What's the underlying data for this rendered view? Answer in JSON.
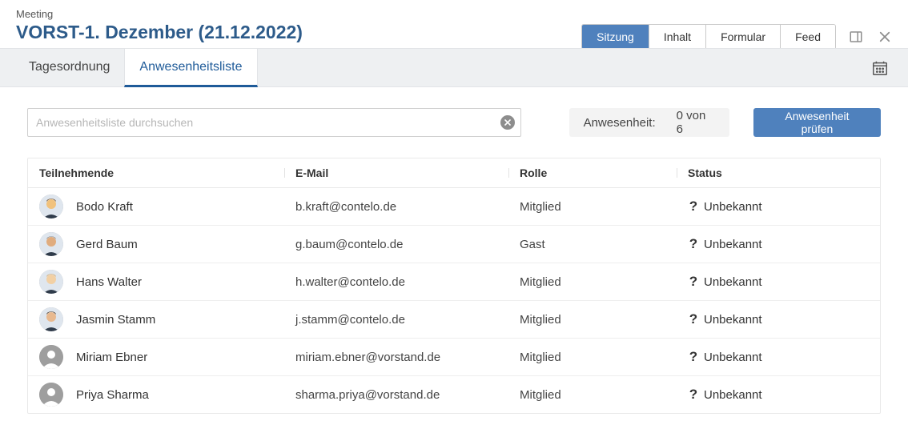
{
  "header": {
    "crumb": "Meeting",
    "title": "VORST-1. Dezember (21.12.2022)",
    "segments": [
      "Sitzung",
      "Inhalt",
      "Formular",
      "Feed"
    ],
    "active_segment": 0
  },
  "tabs": {
    "items": [
      "Tagesordnung",
      "Anwesenheitsliste"
    ],
    "active": 1
  },
  "toolbar": {
    "search_placeholder": "Anwesenheitsliste durchsuchen",
    "summary_label": "Anwesenheit:",
    "summary_value": "0 von 6",
    "check_button": "Anwesenheit prüfen"
  },
  "table": {
    "headers": [
      "Teilnehmende",
      "E-Mail",
      "Rolle",
      "Status"
    ],
    "rows": [
      {
        "name": "Bodo Kraft",
        "email": "b.kraft@contelo.de",
        "role": "Mitglied",
        "status": "Unbekannt",
        "placeholder": false
      },
      {
        "name": "Gerd Baum",
        "email": "g.baum@contelo.de",
        "role": "Gast",
        "status": "Unbekannt",
        "placeholder": false
      },
      {
        "name": "Hans Walter",
        "email": "h.walter@contelo.de",
        "role": "Mitglied",
        "status": "Unbekannt",
        "placeholder": false
      },
      {
        "name": "Jasmin Stamm",
        "email": "j.stamm@contelo.de",
        "role": "Mitglied",
        "status": "Unbekannt",
        "placeholder": false
      },
      {
        "name": "Miriam Ebner",
        "email": "miriam.ebner@vorstand.de",
        "role": "Mitglied",
        "status": "Unbekannt",
        "placeholder": true
      },
      {
        "name": "Priya Sharma",
        "email": "sharma.priya@vorstand.de",
        "role": "Mitglied",
        "status": "Unbekannt",
        "placeholder": true
      }
    ]
  },
  "icons": {
    "panel": "panel-icon",
    "close": "close-icon",
    "calendar": "calendar-icon",
    "clear": "clear-icon",
    "question": "question-icon"
  }
}
